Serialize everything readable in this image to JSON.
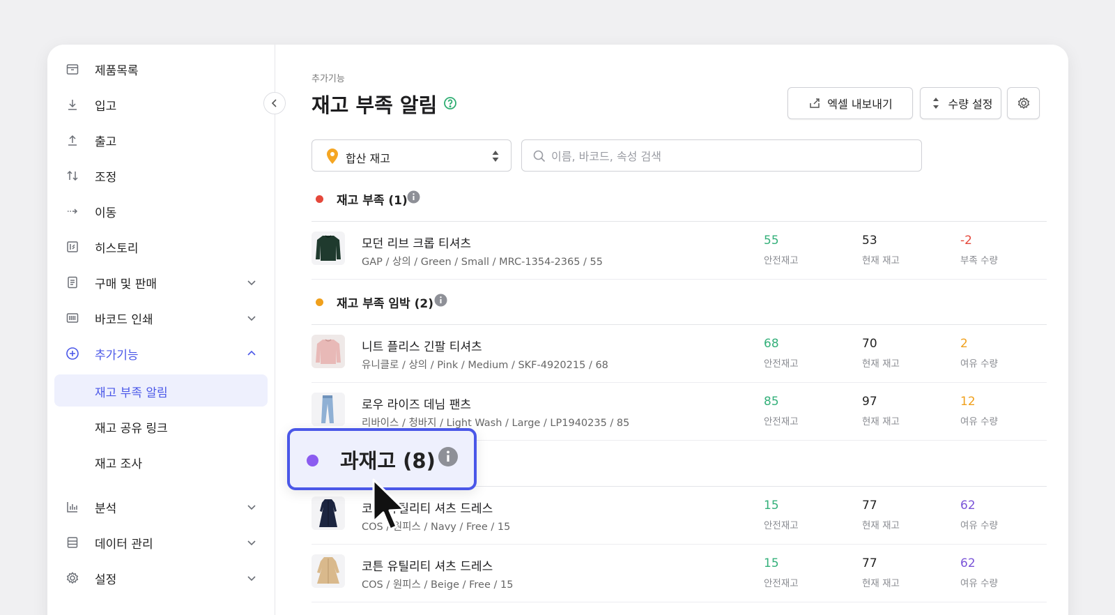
{
  "sidebar": {
    "items": [
      {
        "label": "제품목록"
      },
      {
        "label": "입고"
      },
      {
        "label": "출고"
      },
      {
        "label": "조정"
      },
      {
        "label": "이동"
      },
      {
        "label": "히스토리"
      },
      {
        "label": "구매 및 판매"
      },
      {
        "label": "바코드 인쇄"
      },
      {
        "label": "추가기능"
      },
      {
        "label": "분석"
      },
      {
        "label": "데이터 관리"
      },
      {
        "label": "설정"
      }
    ],
    "sub_items": [
      {
        "label": "재고 부족 알림",
        "selected": true
      },
      {
        "label": "재고 공유 링크"
      },
      {
        "label": "재고 조사"
      }
    ]
  },
  "header": {
    "breadcrumb": "추가기능",
    "title": "재고 부족 알림",
    "export_label": "엑셀 내보내기",
    "qty_label": "수량 설정"
  },
  "filters": {
    "location_value": "합산 재고",
    "search_placeholder": "이름, 바코드, 속성 검색"
  },
  "sections": [
    {
      "title": "재고 부족 (1)",
      "dot_color": "#e5483b",
      "rows": [
        {
          "name": "모던 리브 크롭 티셔츠",
          "meta": "GAP / 상의 / Green / Small / MRC-1354-2365 / 55",
          "safety": "55",
          "safety_cap": "안전재고",
          "current": "53",
          "current_cap": "현재 재고",
          "diff": "-2",
          "diff_cap": "부족 수량",
          "diff_color": "red",
          "thumb": "dark-green-sweater"
        }
      ]
    },
    {
      "title": "재고 부족 임박 (2)",
      "dot_color": "#f0a01c",
      "rows": [
        {
          "name": "니트 플리스 긴팔 티셔츠",
          "meta": "유니클로 / 상의 / Pink / Medium / SKF-4920215 / 68",
          "safety": "68",
          "safety_cap": "안전재고",
          "current": "70",
          "current_cap": "현재 재고",
          "diff": "2",
          "diff_cap": "여유 수량",
          "diff_color": "orange",
          "thumb": "pink-sweater"
        },
        {
          "name": "로우 라이즈 데님 팬츠",
          "meta": "리바이스 / 청바지 / Light Wash / Large / LP1940235 / 85",
          "safety": "85",
          "safety_cap": "안전재고",
          "current": "97",
          "current_cap": "현재 재고",
          "diff": "12",
          "diff_cap": "여유 수량",
          "diff_color": "orange",
          "thumb": "jeans"
        }
      ]
    },
    {
      "title": "과재고 (8)",
      "dot_color": "#8b5cf0",
      "rows": [
        {
          "name": "코튼 유틸리티 셔츠 드레스",
          "meta": "COS / 원피스 / Navy / Free / 15",
          "safety": "15",
          "safety_cap": "안전재고",
          "current": "77",
          "current_cap": "현재 재고",
          "diff": "62",
          "diff_cap": "여유 수량",
          "diff_color": "purple",
          "thumb": "navy-dress"
        },
        {
          "name": "코튼 유틸리티 셔츠 드레스",
          "meta": "COS / 원피스 / Beige / Free / 15",
          "safety": "15",
          "safety_cap": "안전재고",
          "current": "77",
          "current_cap": "현재 재고",
          "diff": "62",
          "diff_cap": "여유 수량",
          "diff_color": "purple",
          "thumb": "beige-coat"
        }
      ]
    }
  ],
  "callout": {
    "title": "과재고 (8)"
  },
  "colors": {
    "accent": "#4a57e8",
    "green": "#34b07a",
    "red": "#e5483b",
    "orange": "#f0a01c",
    "purple": "#7a54d8"
  }
}
